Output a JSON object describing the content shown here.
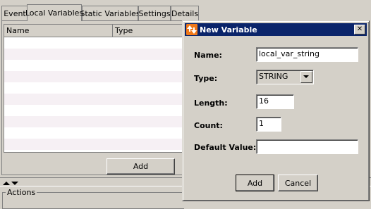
{
  "tabs": [
    {
      "label": "Event"
    },
    {
      "label": "Local Variables"
    },
    {
      "label": "Static Variables"
    },
    {
      "label": "Settings"
    },
    {
      "label": "Details"
    }
  ],
  "table": {
    "columns": [
      {
        "label": "Name"
      },
      {
        "label": "Type"
      }
    ],
    "rows": []
  },
  "add_button_label": "Add",
  "actions_group_label": "Actions",
  "dialog": {
    "title": "New Variable",
    "close_label": "✕",
    "fields": {
      "name": {
        "label": "Name:",
        "value": "local_var_string"
      },
      "type": {
        "label": "Type:",
        "value": "STRING"
      },
      "length": {
        "label": "Length:",
        "value": "16"
      },
      "count": {
        "label": "Count:",
        "value": "1"
      },
      "default_value": {
        "label": "Default Value:",
        "value": ""
      }
    },
    "add_label": "Add",
    "cancel_label": "Cancel"
  },
  "colors": {
    "title_bar": "#0a246a",
    "row_alt": "#f6f0f4",
    "window_bg": "#d4d0c8"
  }
}
